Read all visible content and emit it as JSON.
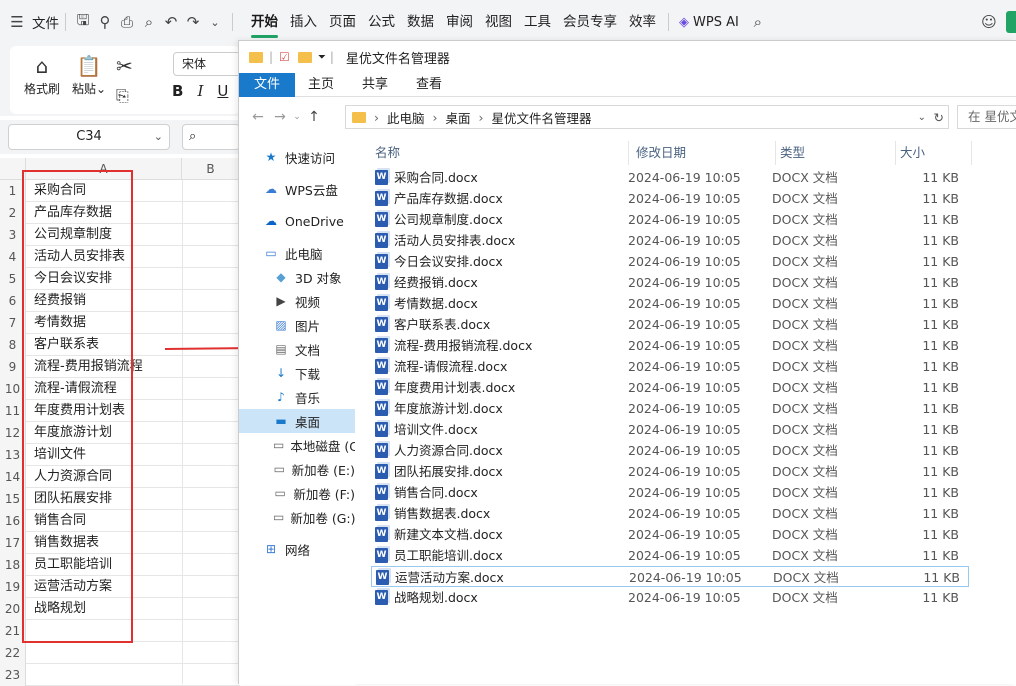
{
  "wps": {
    "menu_file": "文件",
    "menu_tabs": [
      "开始",
      "插入",
      "页面",
      "公式",
      "数据",
      "审阅",
      "视图",
      "工具",
      "会员专享",
      "效率"
    ],
    "ai_label": "WPS AI",
    "tools": {
      "format_painter": "格式刷",
      "paste": "粘贴"
    },
    "font_name": "宋体",
    "name_box": "C34"
  },
  "grid": {
    "columns": [
      "A",
      "B"
    ],
    "rows": [
      {
        "n": "1",
        "a": "采购合同"
      },
      {
        "n": "2",
        "a": "产品库存数据"
      },
      {
        "n": "3",
        "a": "公司规章制度"
      },
      {
        "n": "4",
        "a": "活动人员安排表"
      },
      {
        "n": "5",
        "a": "今日会议安排"
      },
      {
        "n": "6",
        "a": "经费报销"
      },
      {
        "n": "7",
        "a": "考情数据"
      },
      {
        "n": "8",
        "a": "客户联系表"
      },
      {
        "n": "9",
        "a": "流程-费用报销流程"
      },
      {
        "n": "10",
        "a": "流程-请假流程"
      },
      {
        "n": "11",
        "a": "年度费用计划表"
      },
      {
        "n": "12",
        "a": "年度旅游计划"
      },
      {
        "n": "13",
        "a": "培训文件"
      },
      {
        "n": "14",
        "a": "人力资源合同"
      },
      {
        "n": "15",
        "a": "团队拓展安排"
      },
      {
        "n": "16",
        "a": "销售合同"
      },
      {
        "n": "17",
        "a": "销售数据表"
      },
      {
        "n": "18",
        "a": "员工职能培训"
      },
      {
        "n": "19",
        "a": "运营活动方案"
      },
      {
        "n": "20",
        "a": "战略规划"
      },
      {
        "n": "21",
        "a": ""
      },
      {
        "n": "22",
        "a": ""
      },
      {
        "n": "23",
        "a": ""
      }
    ]
  },
  "explorer": {
    "title": "星优文件名管理器",
    "tabs": [
      "文件",
      "主页",
      "共享",
      "查看"
    ],
    "breadcrumb": [
      "此电脑",
      "桌面",
      "星优文件名管理器"
    ],
    "search_placeholder": "在 星优文",
    "nav": [
      {
        "label": "快速访问",
        "icon": "star-icon"
      },
      {
        "label": "WPS云盘",
        "icon": "cloud-icon"
      },
      {
        "label": "OneDrive",
        "icon": "onedrive-icon"
      },
      {
        "label": "此电脑",
        "icon": "computer-icon"
      },
      {
        "label": "3D 对象",
        "icon": "cube-icon"
      },
      {
        "label": "视频",
        "icon": "video-icon"
      },
      {
        "label": "图片",
        "icon": "picture-icon"
      },
      {
        "label": "文档",
        "icon": "document-icon"
      },
      {
        "label": "下载",
        "icon": "download-icon"
      },
      {
        "label": "音乐",
        "icon": "music-icon"
      },
      {
        "label": "桌面",
        "icon": "desktop-icon"
      },
      {
        "label": "本地磁盘 (C",
        "icon": "drive-icon"
      },
      {
        "label": "新加卷 (E:)",
        "icon": "drive-icon"
      },
      {
        "label": "新加卷 (F:)",
        "icon": "drive-icon"
      },
      {
        "label": "新加卷 (G:)",
        "icon": "drive-icon"
      },
      {
        "label": "网络",
        "icon": "network-icon"
      }
    ],
    "columns": {
      "name": "名称",
      "date": "修改日期",
      "type": "类型",
      "size": "大小"
    },
    "files": [
      {
        "name": "采购合同.docx",
        "date": "2024-06-19 10:05",
        "type": "DOCX 文档",
        "size": "11 KB"
      },
      {
        "name": "产品库存数据.docx",
        "date": "2024-06-19 10:05",
        "type": "DOCX 文档",
        "size": "11 KB"
      },
      {
        "name": "公司规章制度.docx",
        "date": "2024-06-19 10:05",
        "type": "DOCX 文档",
        "size": "11 KB"
      },
      {
        "name": "活动人员安排表.docx",
        "date": "2024-06-19 10:05",
        "type": "DOCX 文档",
        "size": "11 KB"
      },
      {
        "name": "今日会议安排.docx",
        "date": "2024-06-19 10:05",
        "type": "DOCX 文档",
        "size": "11 KB"
      },
      {
        "name": "经费报销.docx",
        "date": "2024-06-19 10:05",
        "type": "DOCX 文档",
        "size": "11 KB"
      },
      {
        "name": "考情数据.docx",
        "date": "2024-06-19 10:05",
        "type": "DOCX 文档",
        "size": "11 KB"
      },
      {
        "name": "客户联系表.docx",
        "date": "2024-06-19 10:05",
        "type": "DOCX 文档",
        "size": "11 KB"
      },
      {
        "name": "流程-费用报销流程.docx",
        "date": "2024-06-19 10:05",
        "type": "DOCX 文档",
        "size": "11 KB"
      },
      {
        "name": "流程-请假流程.docx",
        "date": "2024-06-19 10:05",
        "type": "DOCX 文档",
        "size": "11 KB"
      },
      {
        "name": "年度费用计划表.docx",
        "date": "2024-06-19 10:05",
        "type": "DOCX 文档",
        "size": "11 KB"
      },
      {
        "name": "年度旅游计划.docx",
        "date": "2024-06-19 10:05",
        "type": "DOCX 文档",
        "size": "11 KB"
      },
      {
        "name": "培训文件.docx",
        "date": "2024-06-19 10:05",
        "type": "DOCX 文档",
        "size": "11 KB"
      },
      {
        "name": "人力资源合同.docx",
        "date": "2024-06-19 10:05",
        "type": "DOCX 文档",
        "size": "11 KB"
      },
      {
        "name": "团队拓展安排.docx",
        "date": "2024-06-19 10:05",
        "type": "DOCX 文档",
        "size": "11 KB"
      },
      {
        "name": "销售合同.docx",
        "date": "2024-06-19 10:05",
        "type": "DOCX 文档",
        "size": "11 KB"
      },
      {
        "name": "销售数据表.docx",
        "date": "2024-06-19 10:05",
        "type": "DOCX 文档",
        "size": "11 KB"
      },
      {
        "name": "新建文本文档.docx",
        "date": "2024-06-19 10:05",
        "type": "DOCX 文档",
        "size": "11 KB"
      },
      {
        "name": "员工职能培训.docx",
        "date": "2024-06-19 10:05",
        "type": "DOCX 文档",
        "size": "11 KB"
      },
      {
        "name": "运营活动方案.docx",
        "date": "2024-06-19 10:05",
        "type": "DOCX 文档",
        "size": "11 KB"
      },
      {
        "name": "战略规划.docx",
        "date": "2024-06-19 10:05",
        "type": "DOCX 文档",
        "size": "11 KB"
      }
    ]
  },
  "colors": {
    "accent": "#21a366",
    "highlight": "#e03030",
    "explorer_blue": "#1979ca"
  }
}
